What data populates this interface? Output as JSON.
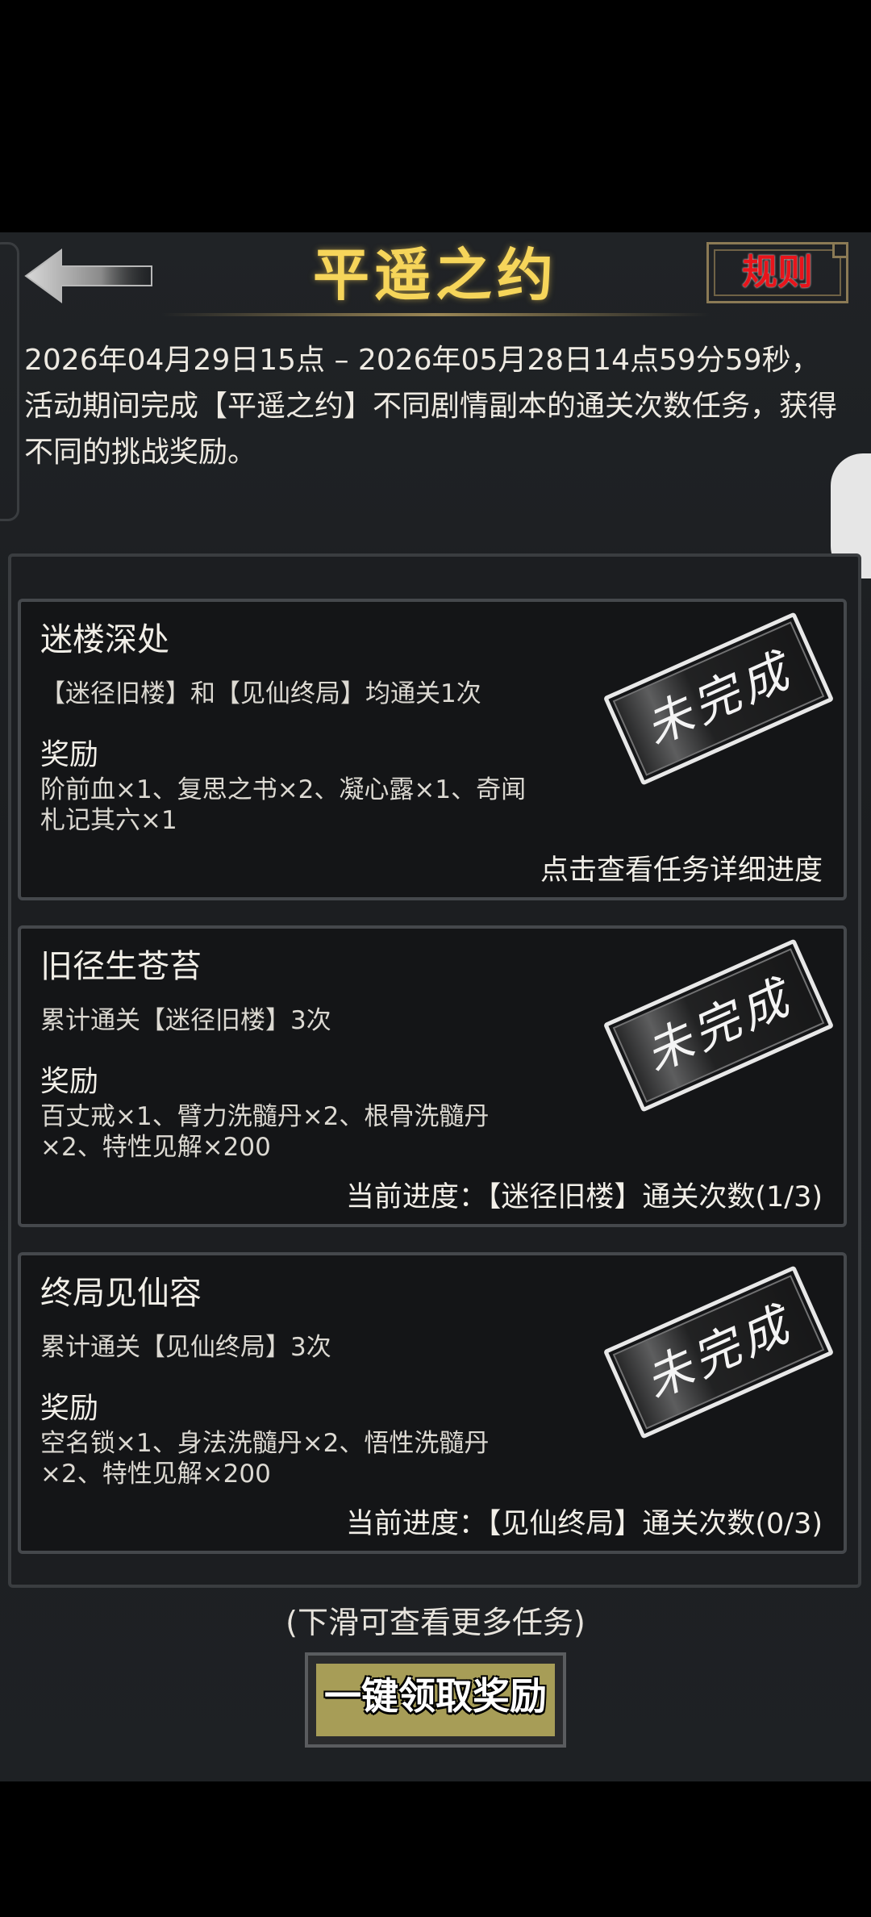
{
  "header": {
    "title": "平遥之约",
    "rules_label": "规则"
  },
  "intro": "2026年04月29日15点 – 2026年05月28日14点59分59秒，活动期间完成【平遥之约】不同剧情副本的通关次数任务，获得不同的挑战奖励。",
  "tasks": [
    {
      "name": "迷楼深处",
      "requirement": "【迷径旧楼】和【见仙终局】均通关1次",
      "reward_heading": "奖励",
      "rewards": "阶前血×1、复思之书×2、凝心露×1、奇闻札记其六×1",
      "status": "未完成",
      "progress": "点击查看任务详细进度"
    },
    {
      "name": "旧径生苍苔",
      "requirement": "累计通关【迷径旧楼】3次",
      "reward_heading": "奖励",
      "rewards": "百丈戒×1、臂力洗髓丹×2、根骨洗髓丹×2、特性见解×200",
      "status": "未完成",
      "progress": "当前进度：【迷径旧楼】通关次数(1/3)"
    },
    {
      "name": "终局见仙容",
      "requirement": "累计通关【见仙终局】3次",
      "reward_heading": "奖励",
      "rewards": "空名锁×1、身法洗髓丹×2、悟性洗髓丹×2、特性见解×200",
      "status": "未完成",
      "progress": "当前进度：【见仙终局】通关次数(0/3)"
    }
  ],
  "footer": {
    "hint": "(下滑可查看更多任务)",
    "claim_label": "一键领取奖励"
  },
  "colors": {
    "title": "#f6d55a",
    "rules": "#e8141b",
    "claim_button": "#a79d57"
  },
  "icons": {
    "back": "back-arrow-icon"
  }
}
